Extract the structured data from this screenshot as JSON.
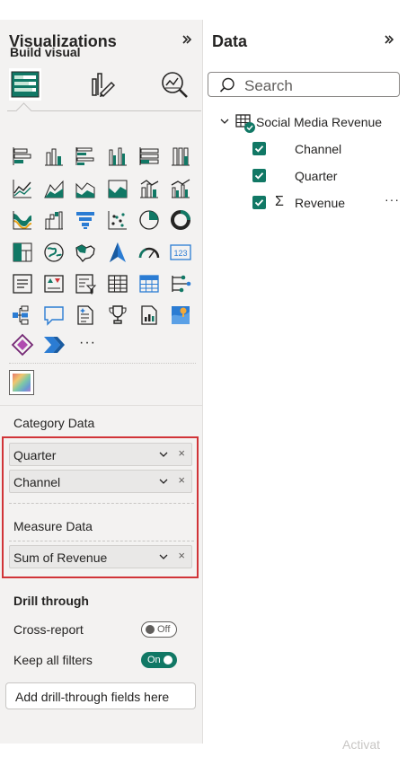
{
  "visualizations": {
    "title": "Visualizations",
    "expand_icon": "double-chevron-right-icon",
    "build_visual_label": "Build visual",
    "tabs": [
      {
        "icon": "build-visual-icon",
        "selected": true
      },
      {
        "icon": "format-visual-icon",
        "selected": false
      },
      {
        "icon": "analytics-icon",
        "selected": false
      }
    ],
    "visual_icons": [
      "stacked-bar-chart-icon",
      "stacked-column-chart-icon",
      "clustered-bar-chart-icon",
      "clustered-column-chart-icon",
      "100-stacked-bar-chart-icon",
      "100-stacked-column-chart-icon",
      "line-chart-icon",
      "area-chart-icon",
      "stacked-area-chart-icon",
      "100-stacked-area-chart-icon",
      "line-and-stacked-column-chart-icon",
      "line-and-clustered-column-chart-icon",
      "ribbon-chart-icon",
      "waterfall-chart-icon",
      "funnel-chart-icon",
      "scatter-chart-icon",
      "pie-chart-icon",
      "donut-chart-icon",
      "treemap-icon",
      "map-icon",
      "filled-map-icon",
      "azure-map-icon",
      "gauge-icon",
      "card-icon",
      "multi-row-card-icon",
      "kpi-icon",
      "slicer-icon",
      "table-icon",
      "matrix-icon",
      "key-influencers-icon",
      "decomposition-tree-icon",
      "qa-icon",
      "smart-narrative-icon",
      "metrics-icon",
      "paginated-report-icon",
      "arcgis-map-icon",
      "power-apps-icon",
      "power-automate-icon"
    ],
    "more_label": "···",
    "custom_visual_icon": "custom-visual-icon"
  },
  "wells": {
    "category_label": "Category Data",
    "category_fields": [
      "Quarter",
      "Channel"
    ],
    "measure_label": "Measure Data",
    "measure_fields": [
      "Sum of Revenue"
    ],
    "remove_glyph": "×"
  },
  "drill": {
    "title": "Drill through",
    "cross_report_label": "Cross-report",
    "cross_report_state": "Off",
    "keep_filters_label": "Keep all filters",
    "keep_filters_state": "On",
    "drop_zone_text": "Add drill-through fields here"
  },
  "data_pane": {
    "title": "Data",
    "expand_icon": "double-chevron-right-icon",
    "search_placeholder": "Search",
    "table_name": "Social Media Revenue",
    "fields": [
      {
        "name": "Channel",
        "checked": true,
        "sigma": false
      },
      {
        "name": "Quarter",
        "checked": true,
        "sigma": false
      },
      {
        "name": "Revenue",
        "checked": true,
        "sigma": true
      }
    ],
    "sigma_glyph": "Σ",
    "more_options": "···"
  },
  "watermark": "Activat",
  "colors": {
    "accent": "#117865",
    "highlight_border": "#d13438",
    "pane_bg": "#f3f2f1"
  }
}
